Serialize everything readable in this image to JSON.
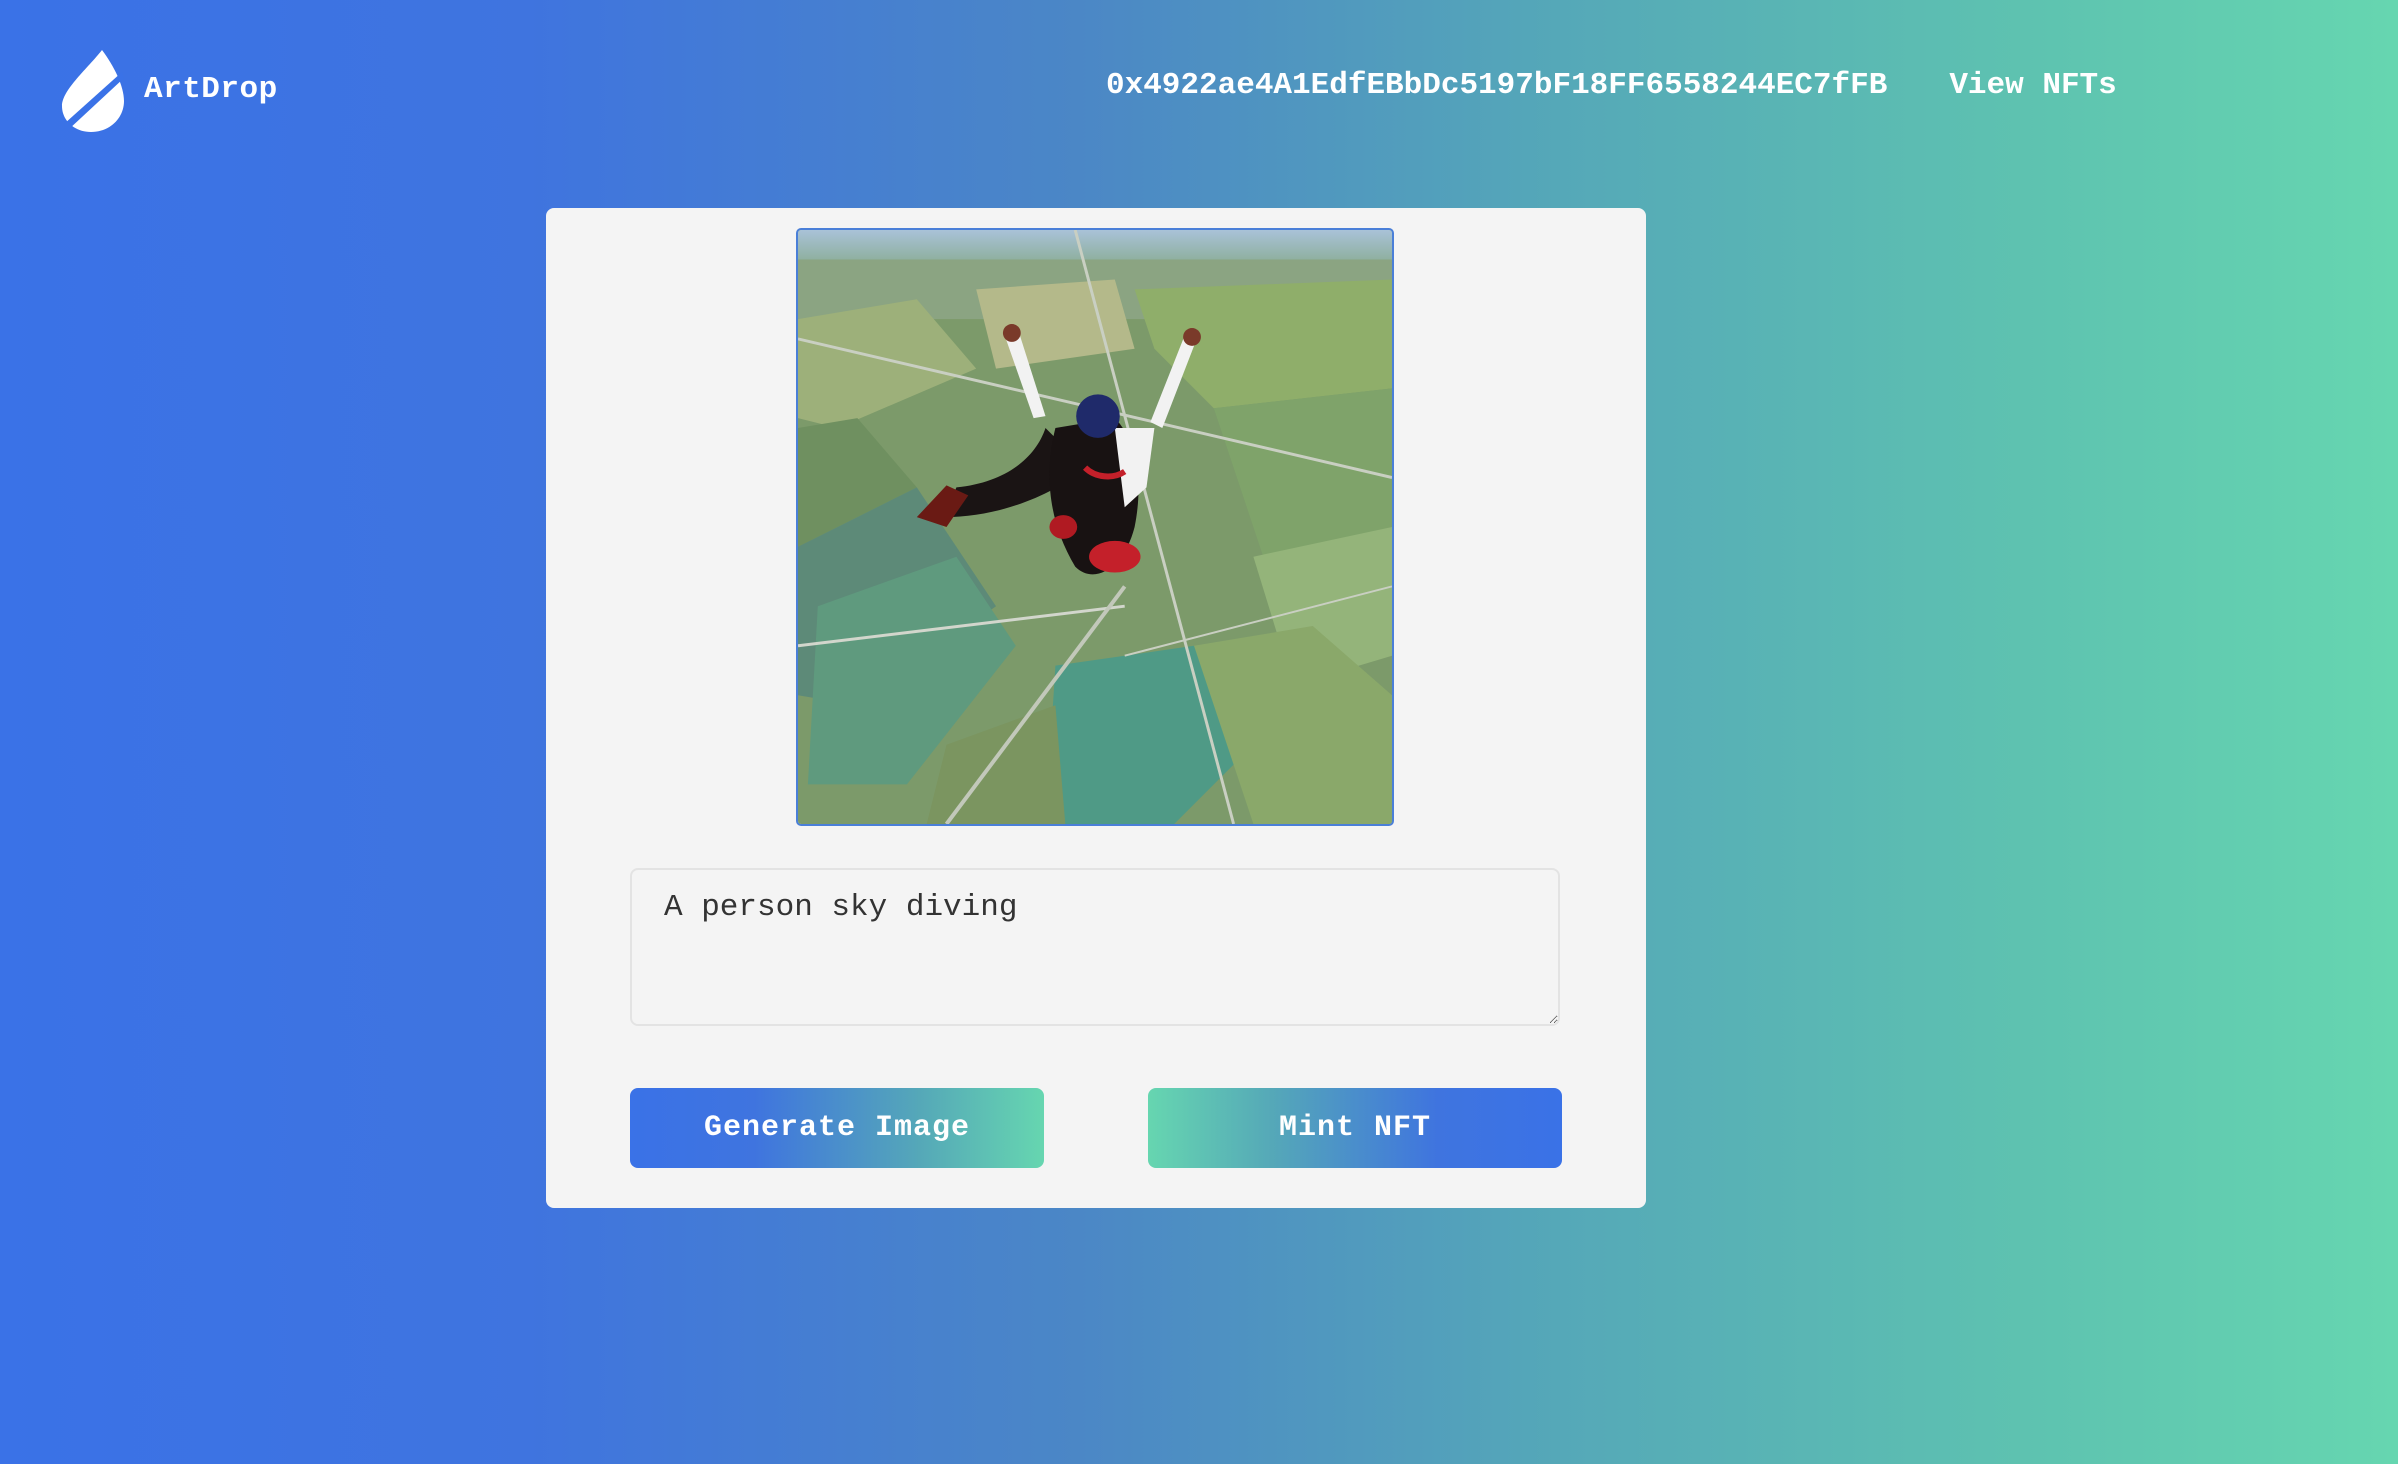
{
  "brand": {
    "name": "ArtDrop",
    "icon": "water-drop-icon"
  },
  "nav": {
    "wallet_address": "0x4922ae4A1EdfEBbDc5197bF18FF6558244EC7fFB",
    "view_nfts_label": "View NFTs"
  },
  "generator": {
    "image_subject": "person skydiving over farmland",
    "prompt_value": "A person sky diving",
    "generate_label": "Generate Image",
    "mint_label": "Mint NFT"
  },
  "colors": {
    "gradient_start": "#3a72e7",
    "gradient_end": "#66d6b0",
    "card_background": "#f4f4f4",
    "image_border": "#4a7fd8"
  }
}
